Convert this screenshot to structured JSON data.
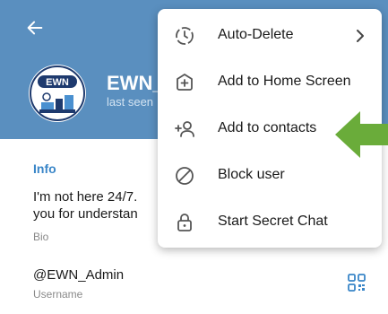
{
  "header": {
    "name": "EWN_",
    "status": "last seen",
    "avatar_text": "EWN",
    "background_color": "#5a8fbf"
  },
  "info": {
    "title": "Info",
    "bio_line1": "I'm not here 24/7.",
    "bio_line2": "you for understan",
    "bio_label": "Bio",
    "username": "@EWN_Admin",
    "username_label": "Username"
  },
  "menu": {
    "items": [
      {
        "label": "Auto-Delete",
        "icon": "timer-icon",
        "has_submenu": true
      },
      {
        "label": "Add to Home Screen",
        "icon": "add-square-icon"
      },
      {
        "label": "Add to contacts",
        "icon": "add-contact-icon"
      },
      {
        "label": "Block user",
        "icon": "block-icon"
      },
      {
        "label": "Start Secret Chat",
        "icon": "lock-icon"
      }
    ]
  },
  "colors": {
    "accent": "#3a86c8",
    "annotation_arrow": "#6aac3a"
  }
}
